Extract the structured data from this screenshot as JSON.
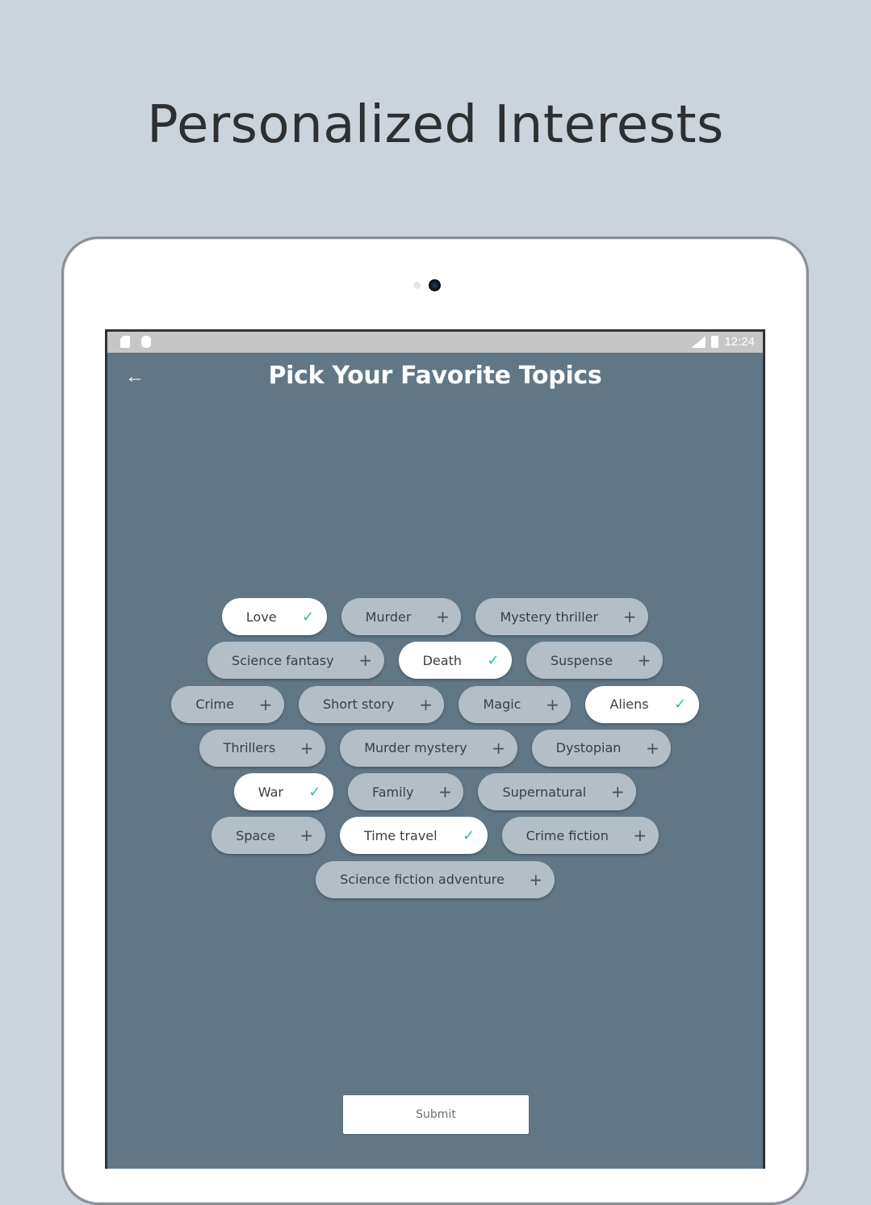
{
  "headline": "Personalized Interests",
  "statusbar": {
    "left_icons": [
      "sd-card-icon",
      "android-icon"
    ],
    "network": "LTE",
    "time": "12:24"
  },
  "appbar": {
    "back_icon": "arrow-left-icon",
    "title": "Pick Your Favorite Topics"
  },
  "colors": {
    "background": "#cbd3dc",
    "screen": "#627786",
    "chip_unselected": "#b3bec6",
    "chip_selected": "#ffffff",
    "check": "#1fc3a2"
  },
  "topics": {
    "rows": [
      [
        {
          "label": "Love",
          "selected": true
        },
        {
          "label": "Murder",
          "selected": false
        },
        {
          "label": "Mystery thriller",
          "selected": false
        }
      ],
      [
        {
          "label": "Science fantasy",
          "selected": false
        },
        {
          "label": "Death",
          "selected": true
        },
        {
          "label": "Suspense",
          "selected": false
        }
      ],
      [
        {
          "label": "Crime",
          "selected": false
        },
        {
          "label": "Short story",
          "selected": false
        },
        {
          "label": "Magic",
          "selected": false
        },
        {
          "label": "Aliens",
          "selected": true
        }
      ],
      [
        {
          "label": "Thrillers",
          "selected": false
        },
        {
          "label": "Murder mystery",
          "selected": false
        },
        {
          "label": "Dystopian",
          "selected": false
        }
      ],
      [
        {
          "label": "War",
          "selected": true
        },
        {
          "label": "Family",
          "selected": false
        },
        {
          "label": "Supernatural",
          "selected": false
        }
      ],
      [
        {
          "label": "Space",
          "selected": false
        },
        {
          "label": "Time travel",
          "selected": true
        },
        {
          "label": "Crime fiction",
          "selected": false
        }
      ],
      [
        {
          "label": "Science fiction adventure",
          "selected": false
        }
      ]
    ],
    "selected_icon": "✓",
    "unselected_icon": "+"
  },
  "submit_label": "Submit"
}
